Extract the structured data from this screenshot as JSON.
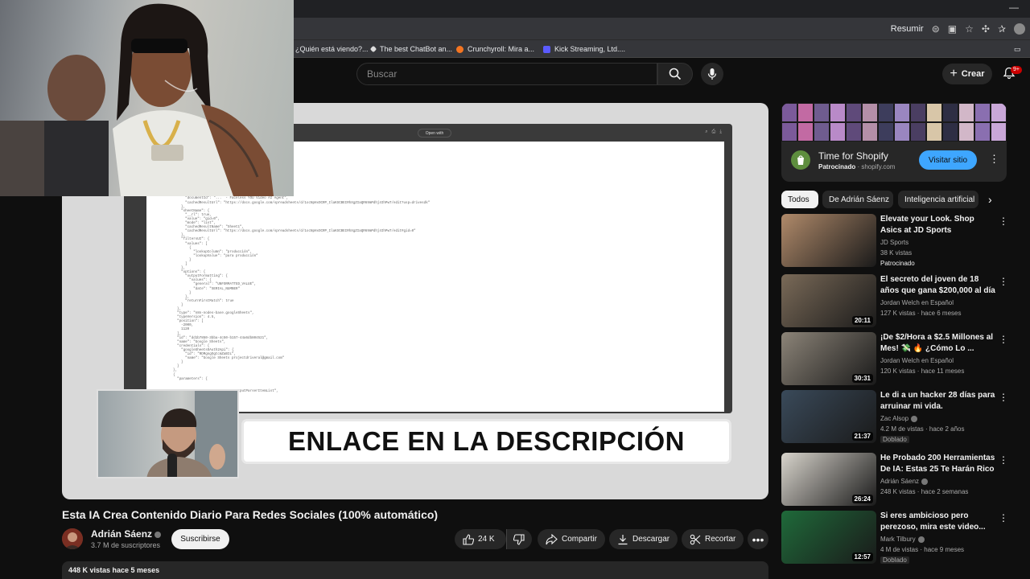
{
  "browser": {
    "resumir_label": "Resumir",
    "bookmarks": [
      {
        "label": "¿Quién está viendo?...",
        "color": "#e50914"
      },
      {
        "label": "The best ChatBot an...",
        "color": "#dddddd"
      },
      {
        "label": "Crunchyroll: Mira a...",
        "color": "#f47521"
      },
      {
        "label": "Kick Streaming, Ltd....",
        "color": "#5b5bff"
      }
    ]
  },
  "header": {
    "search_placeholder": "Buscar",
    "create_label": "Crear",
    "notif_count": "9+"
  },
  "player": {
    "open_with": "Open with",
    "banner_text": "ENLACE EN LA DESCRIPCIÓN",
    "code_lines": [
      "          \"meta\": {",
      "            \"instanceId\": \"a9ed...\"",
      "          },",
      "          \"name\": \"...\",",
      "          \"parameters\": {",
      "            \"documentId\": \"...  - Faceless YOU Video AI Agent\",",
      "            \"cachedResultUrl\": \"https://docs.google.com/spreadsheets/d/1ocNpHxOCRP_IlaKSCBEIRhXgZIaQR69mPdhj4IhPwT/edit?usp=drivesdk\"",
      "          },",
      "          \"sheetName\": {",
      "            \"__rl\": true,",
      "            \"value\": \"gid=0\",",
      "            \"mode\": \"list\",",
      "            \"cachedResultName\": \"Sheet1\",",
      "            \"cachedResultUrl\": \"https://docs.google.com/spreadsheets/d/1ocNpHxOCRP_IlaKSCBEIRhXgZIaQR69mPdhj4IhPwT/edit#gid=0\"",
      "          },",
      "          \"filtersUI\": {",
      "            \"values\": [",
      "              {",
      "                \"lookupColumn\": \"producción\",",
      "                \"lookupValue\": \"para producción\"",
      "              }",
      "            ]",
      "          },",
      "          \"options\": {",
      "            \"outputFormatting\": {",
      "              \"values\": {",
      "                \"general\": \"UNFORMATTED_VALUE\",",
      "                \"date\": \"SERIAL_NUMBER\"",
      "              }",
      "            },",
      "            \"returnFirstMatch\": true",
      "          }",
      "        },",
      "        \"type\": \"n8n-nodes-base.googleSheets\",",
      "        \"typeVersion\": 4.5,",
      "        \"position\": [",
      "          -2000,",
      "          1120",
      "        ],",
      "        \"id\": \"dd1b7850-3bba-4c50-b157-44a6db804521\",",
      "        \"name\": \"Google Sheets\",",
      "        \"credentials\": {",
      "          \"googleSheetsOAuth2Api\": {",
      "            \"id\": \"RDMgngOgtcmZaBIL\",",
      "            \"name\": \"Google Sheets projectdriveral@gmail.com\"",
      "          }",
      "        }",
      "      },",
      "      {",
      "        \"parameters\": {",
      "",
      "",
      "                                 ...outputParserItemList\","
    ]
  },
  "video": {
    "title": "Esta IA Crea Contenido Diario Para Redes Sociales (100% automático)",
    "channel": "Adrián Sáenz",
    "subscribers": "3.7 M de suscriptores",
    "subscribe_label": "Suscribirse",
    "likes": "24 K",
    "share_label": "Compartir",
    "download_label": "Descargar",
    "clip_label": "Recortar",
    "description_meta": "448 K vistas  hace 5 meses"
  },
  "ad": {
    "title": "Time for Shopify",
    "sponsored": "Patrocinado",
    "domain": "shopify.com",
    "cta": "Visitar sitio"
  },
  "chips": [
    "Todos",
    "De Adrián Sáenz",
    "Inteligencia artificial"
  ],
  "recommendations": [
    {
      "title": "Elevate your Look. Shop Asics at JD Sports",
      "channel": "JD Sports",
      "meta": "38 K vistas",
      "badge": "Patrocinado",
      "duration": "",
      "verified": false,
      "thumb": "#b08a6a"
    },
    {
      "title": "El secreto del joven de 18 años que gana $200,000 al día",
      "channel": "Jordan Welch en Español",
      "meta": "127 K vistas · hace 6 meses",
      "badge": "",
      "duration": "20:11",
      "verified": false,
      "thumb": "#7a6a58"
    },
    {
      "title": "¡De $2/Hora a $2.5 Millones al Mes! 💸 🔥 ¿Cómo Lo ...",
      "channel": "Jordan Welch en Español",
      "meta": "120 K vistas · hace 11 meses",
      "badge": "",
      "duration": "30:31",
      "verified": false,
      "thumb": "#8c8478"
    },
    {
      "title": "Le di a un hacker 28 días para arruinar mi vida.",
      "channel": "Zac Alsop",
      "meta": "4.2 M de vistas · hace 2 años",
      "badge": "Doblado",
      "duration": "21:37",
      "verified": true,
      "thumb": "#3a4a5a"
    },
    {
      "title": "He Probado 200 Herramientas De IA: Estas 25 Te Harán Rico",
      "channel": "Adrián Sáenz",
      "meta": "248 K vistas · hace 2 semanas",
      "badge": "",
      "duration": "26:24",
      "verified": true,
      "thumb": "#d8d4cc"
    },
    {
      "title": "Si eres ambicioso pero perezoso, mira este video...",
      "channel": "Mark Tilbury",
      "meta": "4 M de vistas · hace 9 meses",
      "badge": "Doblado",
      "duration": "12:57",
      "verified": true,
      "thumb": "#1f6a3a"
    }
  ]
}
